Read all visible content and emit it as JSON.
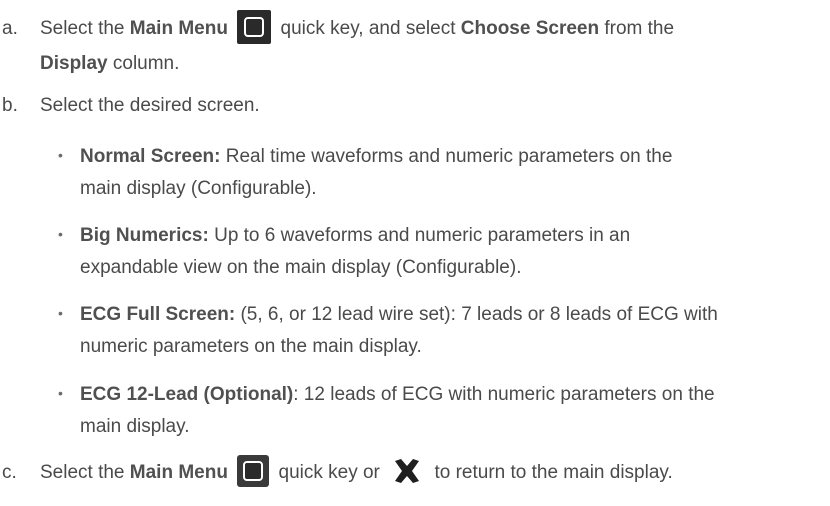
{
  "steps": [
    {
      "marker": "a.",
      "parts": {
        "pre": "Select the ",
        "b1": "Main Menu",
        "mid": " quick key, and  select ",
        "b2": "Choose Screen",
        "post": " from the",
        "b3": "Display",
        "post2": " column."
      }
    },
    {
      "marker": "b.",
      "text": "Select the desired screen."
    },
    {
      "marker": "c.",
      "parts": {
        "pre": "Select the ",
        "b1": "Main Menu",
        "mid": " quick key or ",
        "post": " to return to the main display."
      }
    }
  ],
  "bullets": [
    {
      "title": "Normal Screen:",
      "line1": " Real time waveforms and numeric parameters on the",
      "line2": "main display (Configurable)."
    },
    {
      "title": "Big Numerics:",
      "line1": " Up to 6 waveforms and numeric parameters in an",
      "line2": "expandable view on the main display (Configurable)."
    },
    {
      "title": "ECG Full Screen:",
      "line1": " (5,  6, or 12 lead wire set): 7 leads or 8 leads of ECG with",
      "line2": "numeric parameters on the main display."
    },
    {
      "title": "ECG 12-Lead (Optional)",
      "line1": ": 12 leads of ECG with numeric parameters on the",
      "line2": "main display."
    }
  ],
  "icons": {
    "main_menu": "main-menu-icon",
    "close": "close-x-icon"
  },
  "colors": {
    "text": "#4a4a4a",
    "icon_bg": "#2a2a2a"
  }
}
